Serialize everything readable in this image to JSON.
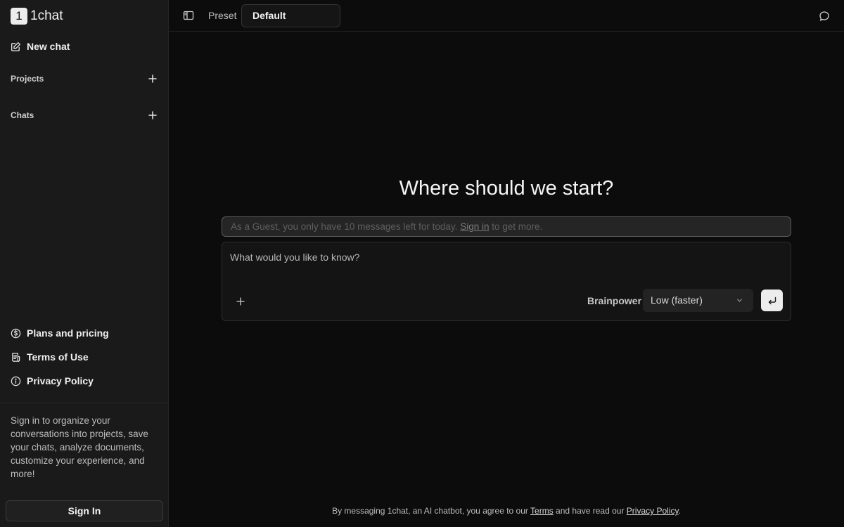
{
  "app": {
    "logo_mark": "1",
    "logo_text": "1chat"
  },
  "sidebar": {
    "new_chat": {
      "label": "New chat",
      "icon": "pencil-square-icon"
    },
    "sections": [
      {
        "label": "Projects",
        "icon": "plus-icon"
      },
      {
        "label": "Chats",
        "icon": "plus-icon"
      }
    ],
    "footer_links": [
      {
        "label": "Plans and pricing",
        "icon": "dollar-circle-icon"
      },
      {
        "label": "Terms of Use",
        "icon": "document-list-icon"
      },
      {
        "label": "Privacy Policy",
        "icon": "info-circle-icon"
      }
    ],
    "signin_note": "Sign in to organize your conversations into projects, save your chats, analyze documents, customize your experience, and more!",
    "signin_button": "Sign In"
  },
  "header": {
    "preset_label": "Preset",
    "preset_value": "Default"
  },
  "main": {
    "hero": "Where should we start?",
    "guest_banner": {
      "before": "As a Guest, you only have 10 messages left for today. ",
      "link": "Sign in",
      "after": " to get more."
    },
    "composer": {
      "placeholder": "What would you like to know?",
      "brainpower_label": "Brainpower",
      "brainpower_value": "Low (faster)"
    },
    "disclaimer": {
      "before": "By messaging 1chat, an AI chatbot, you agree to our ",
      "terms_link": "Terms",
      "middle": " and have read our ",
      "privacy_link": "Privacy Policy",
      "after": "."
    }
  },
  "colors": {
    "sidebar_bg": "#1a1a1a",
    "main_bg": "#0c0c0c",
    "composer_bg": "#141414",
    "send_button_bg": "#ececec"
  }
}
